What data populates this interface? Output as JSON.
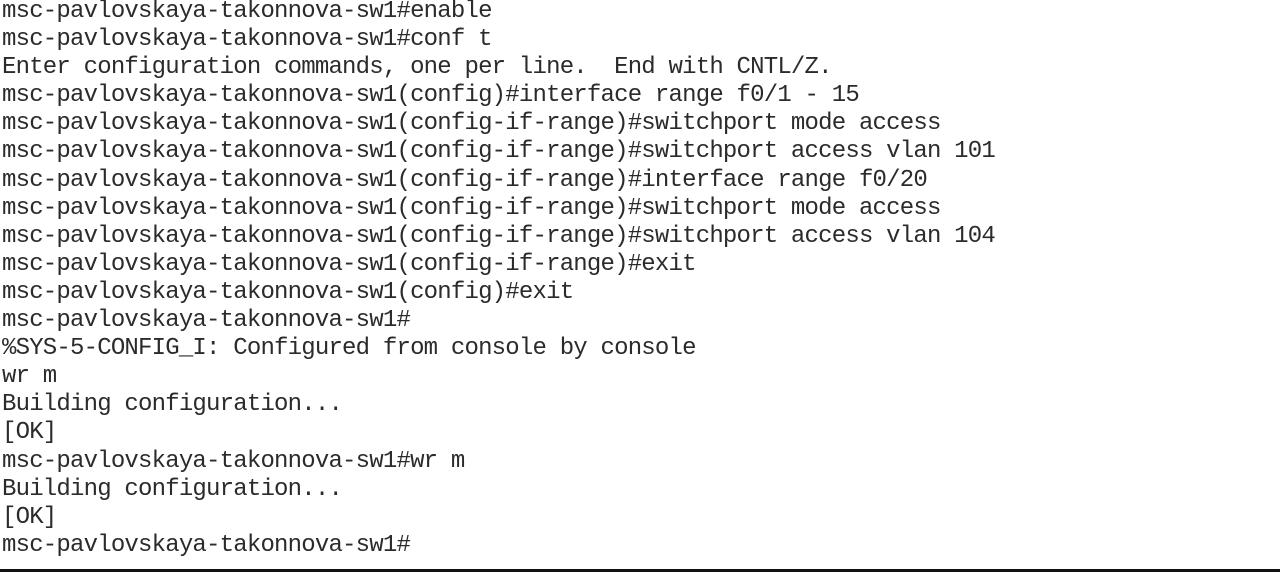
{
  "terminal": {
    "lines": [
      "msc-pavlovskaya-takonnova-sw1#enable",
      "msc-pavlovskaya-takonnova-sw1#conf t",
      "Enter configuration commands, one per line.  End with CNTL/Z.",
      "msc-pavlovskaya-takonnova-sw1(config)#interface range f0/1 - 15",
      "msc-pavlovskaya-takonnova-sw1(config-if-range)#switchport mode access",
      "msc-pavlovskaya-takonnova-sw1(config-if-range)#switchport access vlan 101",
      "msc-pavlovskaya-takonnova-sw1(config-if-range)#interface range f0/20",
      "msc-pavlovskaya-takonnova-sw1(config-if-range)#switchport mode access",
      "msc-pavlovskaya-takonnova-sw1(config-if-range)#switchport access vlan 104",
      "msc-pavlovskaya-takonnova-sw1(config-if-range)#exit",
      "msc-pavlovskaya-takonnova-sw1(config)#exit",
      "msc-pavlovskaya-takonnova-sw1#",
      "%SYS-5-CONFIG_I: Configured from console by console",
      "wr m",
      "Building configuration...",
      "[OK]",
      "msc-pavlovskaya-takonnova-sw1#wr m",
      "Building configuration...",
      "[OK]",
      "msc-pavlovskaya-takonnova-sw1#"
    ]
  }
}
